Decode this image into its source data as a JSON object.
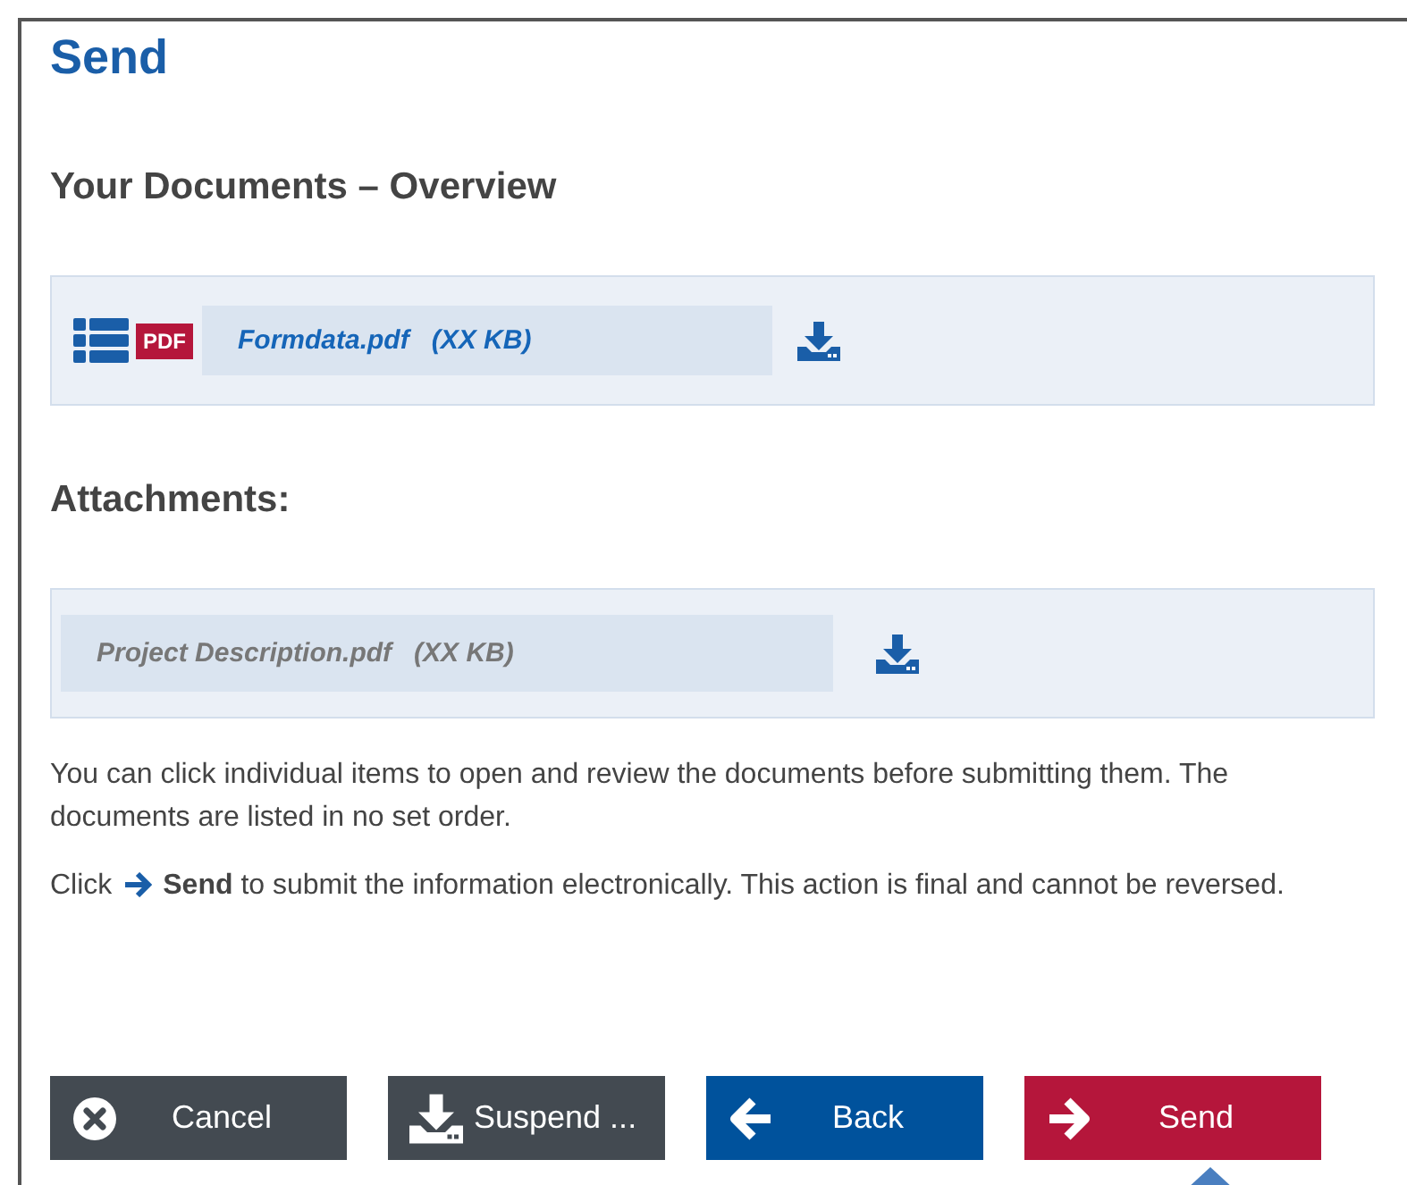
{
  "title": "Send",
  "documents": {
    "heading": "Your Documents – Overview",
    "files": [
      {
        "name": "Formdata.pdf",
        "size": "(XX KB)",
        "badge": "PDF"
      }
    ]
  },
  "attachments": {
    "heading": "Attachments:",
    "files": [
      {
        "name": "Project Description.pdf",
        "size": "(XX KB)"
      }
    ]
  },
  "instructions": [
    {
      "kind": "plain",
      "text": "You can click individual items to open and review the documents before submitting them. The documents are listed in no set order."
    },
    {
      "kind": "send-hint",
      "prefix": "Click",
      "text": "**Send** to submit the information electronically. This action is final and cannot be reversed."
    }
  ],
  "buttons": [
    {
      "kind": "cancel",
      "label": "Cancel"
    },
    {
      "kind": "suspend",
      "label": "Suspend ..."
    },
    {
      "kind": "back",
      "label": "Back"
    },
    {
      "kind": "send",
      "label": "Send"
    }
  ]
}
